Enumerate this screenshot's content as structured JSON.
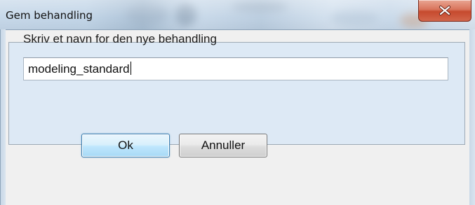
{
  "window": {
    "title": "Gem behandling",
    "close_icon": "close-x-icon",
    "close_label": "X"
  },
  "form": {
    "prompt": "Skriv et navn for den nye behandling",
    "name_value": "modeling_standard"
  },
  "buttons": {
    "ok_label": "Ok",
    "cancel_label": "Annuller"
  },
  "colors": {
    "client_background": "#f0f0f0",
    "group_background": "#dde9f5",
    "close_button": "#c64a2e",
    "default_button_border": "#3c7fb1"
  }
}
